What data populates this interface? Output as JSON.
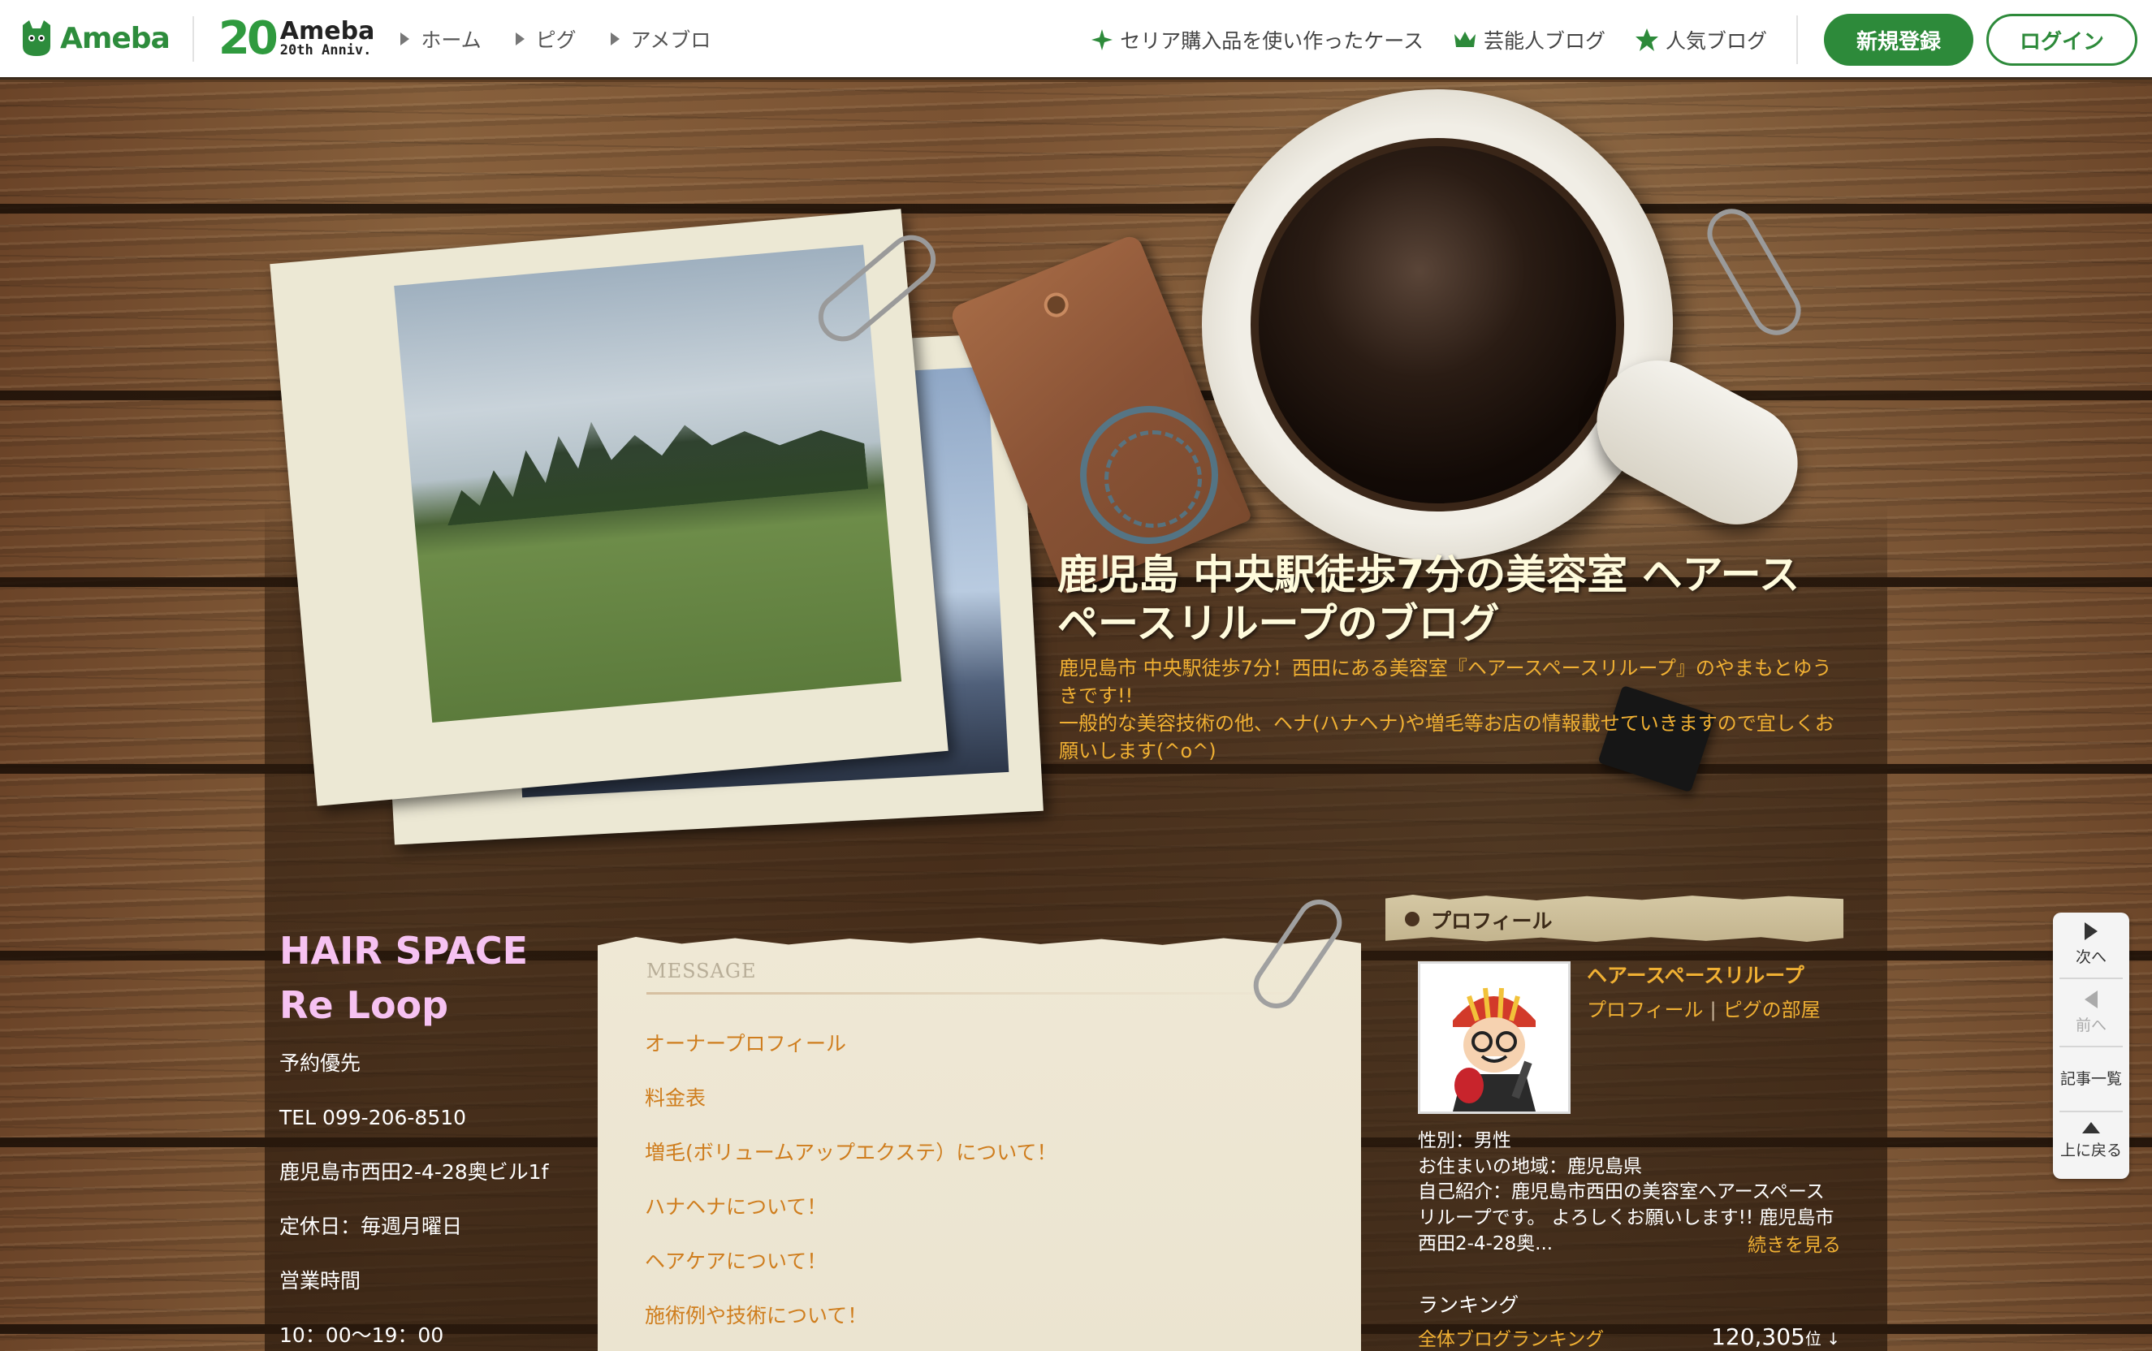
{
  "topbar": {
    "logo_text": "Ameba",
    "anniv_number": "20",
    "anniv_title": "Ameba",
    "anniv_sub": "20th Anniv.",
    "nav": [
      {
        "label": "ホーム"
      },
      {
        "label": "ピグ"
      },
      {
        "label": "アメブロ"
      }
    ],
    "right_nav": [
      {
        "label": "セリア購入品を使い作ったケース",
        "icon": "sparkle-icon"
      },
      {
        "label": "芸能人ブログ",
        "icon": "crown-icon"
      },
      {
        "label": "人気ブログ",
        "icon": "star-icon"
      }
    ],
    "register_label": "新規登録",
    "login_label": "ログイン",
    "brand_color": "#2d8a3a"
  },
  "header": {
    "title": "鹿児島 中央駅徒歩7分の美容室 ヘアースペースリループのブログ",
    "description_line1": "鹿児島市 中央駅徒歩7分！西田にある美容室『ヘアースペースリループ』のやまもとゆうきです!!",
    "description_line2": "一般的な美容技術の他、ヘナ(ハナヘナ)や増毛等お店の情報載せていきますので宜しくお願いします(^o^)"
  },
  "sidebar_left": {
    "shop_name": "HAIR SPACE Re Loop",
    "lines": [
      "予約優先",
      "TEL 099-206-8510",
      "鹿児島市西田2-4-28奥ビル1f",
      "定休日：毎週月曜日",
      "営業時間",
      "10：00〜19：00"
    ]
  },
  "message": {
    "heading": "MESSAGE",
    "links": [
      "オーナープロフィール",
      "料金表",
      "増毛(ボリュームアップエクステ）について！",
      "ハナヘナについて！",
      "ヘアケアについて！",
      "施術例や技術について！"
    ]
  },
  "profile": {
    "heading": "プロフィール",
    "name": "ヘアースペースリループ",
    "link_profile": "プロフィール",
    "link_separator": "|",
    "link_pig": "ピグの部屋",
    "gender": "性別：男性",
    "region": "お住まいの地域：鹿児島県",
    "intro": "自己紹介：鹿児島市西田の美容室ヘアースペースリループです。 よろしくお願いします!! 鹿児島市西田2-4-28奥...",
    "more_label": "続きを見る",
    "ranking_title": "ランキング",
    "ranking_label": "全体ブログランキング",
    "ranking_value": "120,305",
    "ranking_unit": "位 ↓"
  },
  "sidenav": {
    "next": "次へ",
    "prev": "前へ",
    "list": "記事一覧",
    "top": "上に戻る"
  }
}
